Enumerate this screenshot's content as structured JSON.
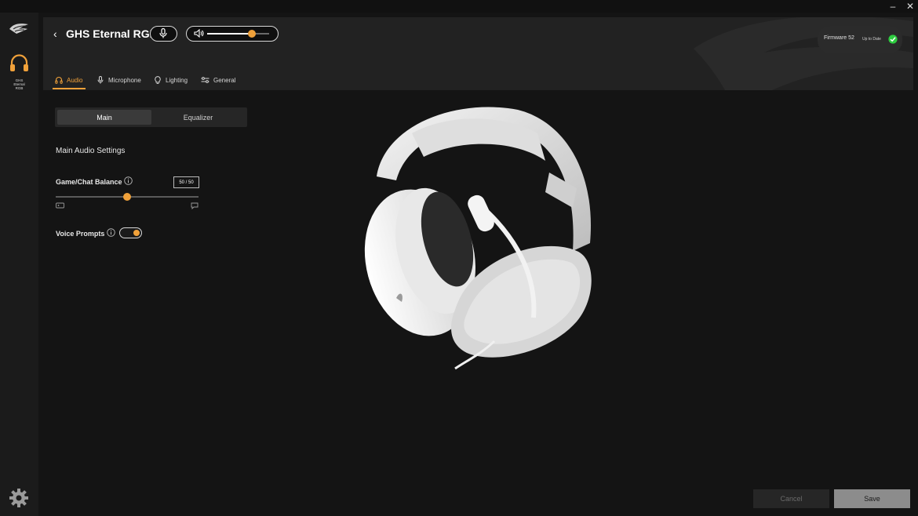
{
  "window": {
    "minimize_glyph": "–",
    "close_glyph": "✕"
  },
  "sidebar": {
    "logo_icon": "brand-wing-icon",
    "device": {
      "icon": "headset-icon",
      "label_lines": [
        "GHS",
        "Eternal",
        "RGB"
      ]
    },
    "settings_icon": "gear-icon"
  },
  "header": {
    "back_glyph": "‹",
    "device_name": "GHS Eternal RGB",
    "mic_icon": "microphone-icon",
    "volume_icon": "speaker-icon",
    "volume_level": 0.72,
    "firmware": {
      "label": "Firmware 52",
      "status": "Up to Date",
      "status_color": "#2ecc40"
    }
  },
  "tabs": [
    {
      "label": "Audio",
      "icon": "headphones-icon",
      "active": true
    },
    {
      "label": "Microphone",
      "icon": "microphone-icon",
      "active": false
    },
    {
      "label": "Lighting",
      "icon": "bulb-icon",
      "active": false
    },
    {
      "label": "General",
      "icon": "sliders-icon",
      "active": false
    }
  ],
  "segments": {
    "main": "Main",
    "equalizer": "Equalizer",
    "active": "main"
  },
  "main_settings": {
    "title": "Main Audio Settings",
    "balance": {
      "label": "Game/Chat Balance",
      "value": "50 / 50",
      "position": 0.5,
      "left_icon": "game-controller-icon",
      "right_icon": "chat-bubble-icon"
    },
    "voice_prompts": {
      "label": "Voice Prompts",
      "enabled": true
    }
  },
  "footer": {
    "cancel": "Cancel",
    "save": "Save"
  },
  "colors": {
    "accent": "#f0a13a",
    "background": "#141414",
    "header": "#222222"
  }
}
